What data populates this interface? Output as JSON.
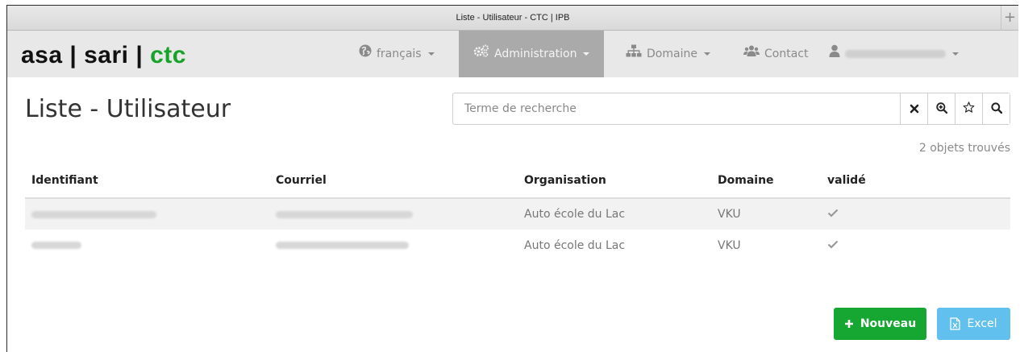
{
  "window": {
    "title": "Liste - Utilisateur - CTC | IPB",
    "new_tab": "+"
  },
  "brand": {
    "part1": "asa | sari | ",
    "part2": "ctc"
  },
  "nav": {
    "language": {
      "label": "français",
      "icon": "globe-icon"
    },
    "administration": {
      "label": "Administration",
      "icon": "cogs-icon"
    },
    "domaine": {
      "label": "Domaine",
      "icon": "sitemap-icon"
    },
    "contact": {
      "label": "Contact",
      "icon": "users-icon"
    },
    "user": {
      "icon": "user-icon"
    }
  },
  "page": {
    "title": "Liste - Utilisateur"
  },
  "search": {
    "placeholder": "Terme de recherche",
    "value": "",
    "buttons": [
      "clear-icon",
      "zoom-in-icon",
      "star-icon",
      "search-icon"
    ]
  },
  "results": {
    "count_text": "2 objets trouvés"
  },
  "table": {
    "headers": [
      "Identifiant",
      "Courriel",
      "Organisation",
      "Domaine",
      "validé"
    ],
    "rows": [
      {
        "organisation": "Auto école du Lac",
        "domaine": "VKU",
        "valide_icon": "check-icon"
      },
      {
        "organisation": "Auto école du Lac",
        "domaine": "VKU",
        "valide_icon": "check-icon"
      }
    ]
  },
  "actions": {
    "new_label": "Nouveau",
    "excel_label": "Excel"
  },
  "colors": {
    "accent_green": "#16a632",
    "excel_blue": "#61c0ee",
    "nav_active": "#aaaaaa",
    "navbar_bg": "#e8e8e8"
  }
}
